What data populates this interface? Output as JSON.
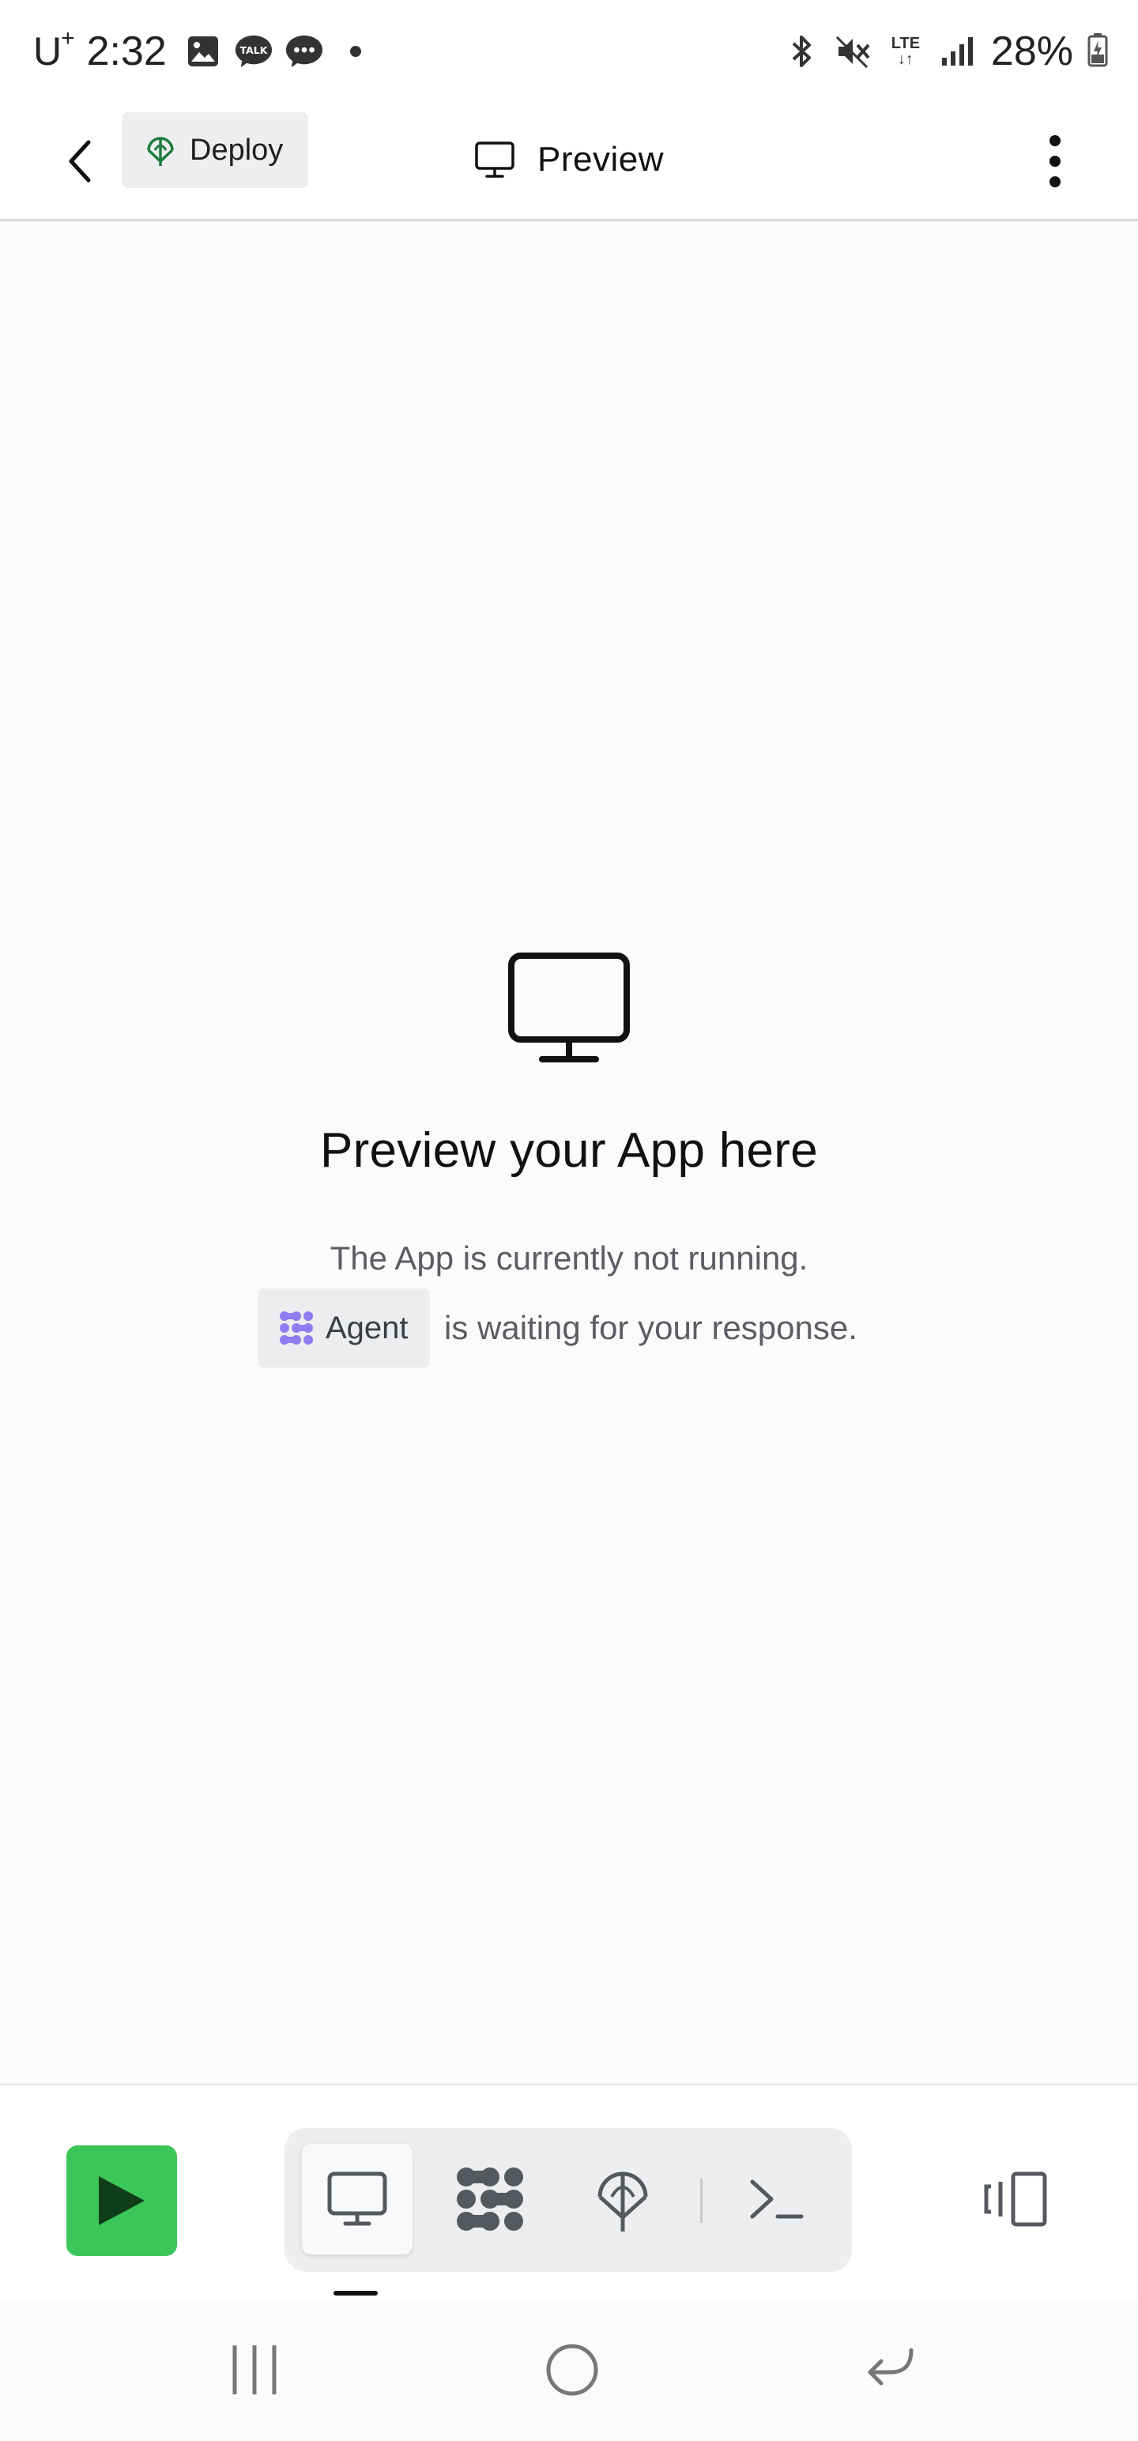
{
  "status_bar": {
    "carrier": "U",
    "carrier_sup": "+",
    "time": "2:32",
    "battery": "28%",
    "network": "LTE"
  },
  "header": {
    "deploy_label": "Deploy",
    "title": "Preview"
  },
  "empty_state": {
    "title": "Preview your App here",
    "line1": "The App is currently not running.",
    "agent_chip": "Agent",
    "line2": "is waiting for your response."
  },
  "toolbar": {
    "tools": [
      "preview-icon",
      "agent-icon",
      "deploy-icon",
      "shell-icon"
    ],
    "active_tool": "preview"
  },
  "colors": {
    "run_green": "#3cc65a",
    "agent_purple": "#8f7cf0",
    "deploy_green": "#1e7a3c"
  }
}
